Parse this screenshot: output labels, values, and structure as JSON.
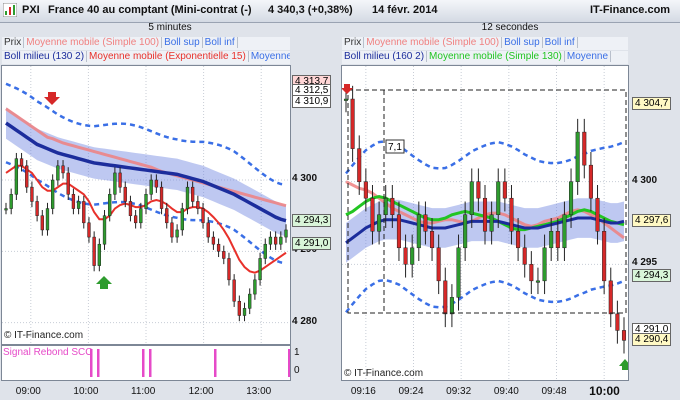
{
  "header": {
    "app": "PXI",
    "instrument": "France 40 au comptant (Mini-contrat  (-)",
    "quote": "4 340,3 (+0,38%)",
    "date": "14 févr. 2014",
    "brand": "IT-Finance.com"
  },
  "colors": {
    "up": "#2e9c2e",
    "down": "#d62828",
    "ema": "#e8312b",
    "ma100": "#f08080",
    "boll": "#1c2d9c",
    "boll_fill": "#6f86e0",
    "boll_dash": "#3a6fe6",
    "ma130": "#22c522"
  },
  "chart_data": [
    {
      "type": "line",
      "title": "5 minutes",
      "legend": [
        "Prix",
        "Moyenne mobile (Simple 100)",
        "Boll sup",
        "Boll inf",
        "Boll milieu (130 2)",
        "Moyenne mobile (Exponentielle 15)",
        "Moyenne"
      ],
      "y_ticks": [
        "4 300",
        "4 290",
        "4 280"
      ],
      "ylim": [
        4277,
        4316
      ],
      "x_ticks": [
        "09:00",
        "10:00",
        "11:00",
        "12:00",
        "13:00"
      ],
      "value_tags": [
        "4 313,7",
        "4 312,5",
        "4 310,9",
        "4 294,3",
        "4 291,0"
      ],
      "indicator_label": "Signal Rebond SCO",
      "indicator_scale": [
        "1",
        "0"
      ],
      "credit": "© IT-Finance.com",
      "series": [
        {
          "name": "Prix",
          "values": [
            4296,
            4298,
            4303,
            4302,
            4299,
            4297,
            4295,
            4293,
            4296,
            4300,
            4302,
            4301,
            4298,
            4296,
            4297,
            4294,
            4292,
            4288,
            4291,
            4295,
            4298,
            4301,
            4299,
            4297,
            4295,
            4294,
            4296,
            4298,
            4300,
            4299,
            4296,
            4294,
            4292,
            4293,
            4296,
            4299,
            4297,
            4296,
            4294,
            4292,
            4291,
            4290,
            4289,
            4286,
            4283,
            4281,
            4282,
            4284,
            4286,
            4289,
            4291,
            4292,
            4291,
            4292,
            4293
          ]
        },
        {
          "name": "Moyenne mobile (Simple 100)",
          "values": [
            4310,
            4309.5,
            4309,
            4308.5,
            4308,
            4307.5,
            4307,
            4306.5,
            4306,
            4305.8,
            4305.5,
            4305.2,
            4305,
            4304.8,
            4304.6,
            4304.4,
            4304.2,
            4304,
            4303.8,
            4303.6,
            4303.4,
            4303.2,
            4303,
            4302.8,
            4302.6,
            4302.4,
            4302.2,
            4302,
            4301.8,
            4301.5,
            4301.2,
            4301,
            4300.8,
            4300.6,
            4300.4,
            4300.2,
            4300,
            4299.8,
            4299.6,
            4299.4,
            4299.2,
            4299,
            4298.8,
            4298.6,
            4298.4,
            4298.2,
            4298,
            4297.8,
            4297.6,
            4297.4,
            4297.2,
            4297,
            4296.8,
            4296.6,
            4296.4
          ]
        },
        {
          "name": "Boll milieu (130 2)",
          "values": [
            4308,
            4307.5,
            4307,
            4306.5,
            4306,
            4305.5,
            4305,
            4304.7,
            4304.4,
            4304.1,
            4303.8,
            4303.6,
            4303.4,
            4303.2,
            4303,
            4302.8,
            4302.6,
            4302.4,
            4302.3,
            4302.2,
            4302.1,
            4302,
            4301.9,
            4301.8,
            4301.7,
            4301.6,
            4301.5,
            4301.4,
            4301.3,
            4301.2,
            4301.1,
            4301,
            4300.9,
            4300.8,
            4300.6,
            4300.4,
            4300.2,
            4300,
            4299.8,
            4299.5,
            4299.2,
            4298.9,
            4298.6,
            4298.3,
            4298,
            4297.6,
            4297.2,
            4296.8,
            4296.4,
            4296,
            4295.6,
            4295.2,
            4294.8,
            4294.5,
            4294.3
          ]
        },
        {
          "name": "Moyenne mobile (Exponentielle 15)",
          "values": [
            4301,
            4301.5,
            4302,
            4302,
            4301.5,
            4301,
            4300,
            4299,
            4298.5,
            4298.5,
            4299,
            4299.5,
            4299.5,
            4299,
            4298.5,
            4298,
            4297,
            4295.5,
            4294.5,
            4294.5,
            4295,
            4296,
            4296.5,
            4296.7,
            4296.5,
            4296.2,
            4296.2,
            4296.5,
            4297,
            4297.2,
            4297,
            4296.6,
            4296,
            4295.5,
            4295.5,
            4296,
            4296.2,
            4296.2,
            4296,
            4295.5,
            4294.8,
            4294,
            4293,
            4291.8,
            4290.3,
            4288.8,
            4287.8,
            4287.2,
            4287,
            4287.3,
            4287.8,
            4288.3,
            4288.8,
            4289.3,
            4289.8
          ]
        }
      ]
    },
    {
      "type": "line",
      "title": "12 secondes",
      "legend": [
        "Prix",
        "Moyenne mobile (Simple 100)",
        "Boll sup",
        "Boll inf",
        "Boll milieu (160 2)",
        "Moyenne mobile (Simple 130)",
        "Moyenne"
      ],
      "y_ticks": [
        "4 300",
        "4 295"
      ],
      "ylim": [
        4288,
        4307
      ],
      "x_ticks": [
        "09:16",
        "09:24",
        "09:32",
        "09:40",
        "09:48",
        "10:00"
      ],
      "value_tags": [
        "4 304,7",
        "4 297,6",
        "4 294,3",
        "4 291,0",
        "4 290,4"
      ],
      "cursor_label": "7,1",
      "credit": "© IT-Finance.com",
      "series": [
        {
          "name": "Prix",
          "values": [
            4305,
            4302,
            4300,
            4299,
            4297,
            4298,
            4299,
            4298,
            4296,
            4295,
            4296,
            4298,
            4297,
            4296,
            4294,
            4292,
            4293,
            4296,
            4298,
            4300,
            4299,
            4297,
            4298,
            4300,
            4299,
            4297,
            4296,
            4295,
            4294,
            4294,
            4296,
            4297,
            4296,
            4298,
            4300,
            4303,
            4301,
            4299,
            4297,
            4294,
            4292,
            4291,
            4290.4
          ]
        },
        {
          "name": "Moyenne mobile (Simple 100)",
          "values": [
            4300,
            4299.8,
            4299.6,
            4299.5,
            4299.3,
            4299,
            4298.7,
            4298.4,
            4298.2,
            4298,
            4297.8,
            4297.6,
            4297.5,
            4297.5,
            4297.6,
            4297.7,
            4297.7,
            4297.6,
            4297.5,
            4297.6,
            4297.8,
            4298,
            4298.1,
            4298.1,
            4298,
            4297.8,
            4297.6,
            4297.4,
            4297.3,
            4297.4,
            4297.6,
            4297.7,
            4297.8,
            4298,
            4298.2,
            4298.3,
            4298.2,
            4298,
            4297.8,
            4297.5,
            4297.2,
            4296.9,
            4296.6
          ]
        },
        {
          "name": "Moyenne mobile (Simple 130)",
          "values": [
            4298,
            4298.2,
            4298.5,
            4298.8,
            4299,
            4299.1,
            4299,
            4298.8,
            4298.6,
            4298.4,
            4298.2,
            4298,
            4297.8,
            4297.7,
            4297.7,
            4297.8,
            4298,
            4298.1,
            4298.2,
            4298.1,
            4298,
            4297.9,
            4297.8,
            4297.6,
            4297.4,
            4297.2,
            4297.1,
            4297.1,
            4297.2,
            4297.3,
            4297.4,
            4297.5,
            4297.6,
            4297.8,
            4298,
            4298.2,
            4298.3,
            4298.2,
            4298,
            4297.8,
            4297.6,
            4297.5,
            4297.4
          ]
        },
        {
          "name": "Boll milieu (160 2)",
          "values": [
            4296.3,
            4296.6,
            4296.9,
            4297.2,
            4297.4,
            4297.6,
            4297.7,
            4297.7,
            4297.7,
            4297.6,
            4297.5,
            4297.4,
            4297.3,
            4297.2,
            4297.2,
            4297.2,
            4297.3,
            4297.4,
            4297.5,
            4297.6,
            4297.6,
            4297.6,
            4297.6,
            4297.6,
            4297.5,
            4297.4,
            4297.3,
            4297.2,
            4297.2,
            4297.2,
            4297.3,
            4297.4,
            4297.5,
            4297.6,
            4297.7,
            4297.8,
            4297.8,
            4297.8,
            4297.7,
            4297.6,
            4297.5,
            4297.5,
            4297.6
          ]
        }
      ]
    }
  ]
}
